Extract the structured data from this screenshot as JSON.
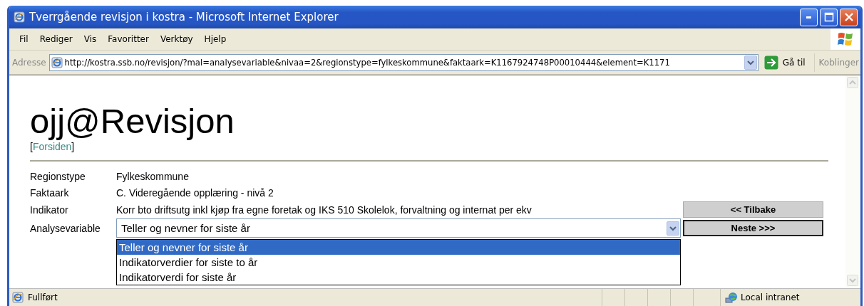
{
  "window": {
    "title": "Tverrgående revisjon i kostra - Microsoft Internet Explorer"
  },
  "menu": [
    "Fil",
    "Rediger",
    "Vis",
    "Favoritter",
    "Verktøy",
    "Hjelp"
  ],
  "address_bar": {
    "label": "Adresse",
    "url": "http://kostra.ssb.no/revisjon/?mal=analysevariable&nivaa=2&regionstype=fylkeskommune&faktaark=K1167924748P00010444&element=K1171",
    "go": "Gå til",
    "links": "Koblinger"
  },
  "page": {
    "heading": "ojj@Revisjon",
    "home_link": {
      "before": "[",
      "label": "Forsiden",
      "after": "]"
    },
    "fields": [
      {
        "label": "Regionstype",
        "value": "Fylkeskommune"
      },
      {
        "label": "Faktaark",
        "value": "C. Videregående opplæring - nivå 2"
      },
      {
        "label": "Indikator",
        "value": "Korr bto driftsutg inkl kjøp fra egne foretak og IKS 510 Skolelok, forvaltning og internat per ekv"
      }
    ],
    "select": {
      "label": "Analysevariable",
      "value": "Teller og nevner for siste år",
      "expanded": true,
      "options": [
        {
          "label": "Teller og nevner for siste år",
          "selected": true
        },
        {
          "label": "Indikatorverdier for siste to år",
          "selected": false
        },
        {
          "label": "Indikatorverdi for siste år",
          "selected": false
        }
      ]
    },
    "buttons": [
      {
        "label": "<< Tilbake",
        "default": false
      },
      {
        "label": "Neste >>>",
        "default": true
      }
    ]
  },
  "status_bar": {
    "text": "Fullført",
    "zone": "Local intranet"
  }
}
